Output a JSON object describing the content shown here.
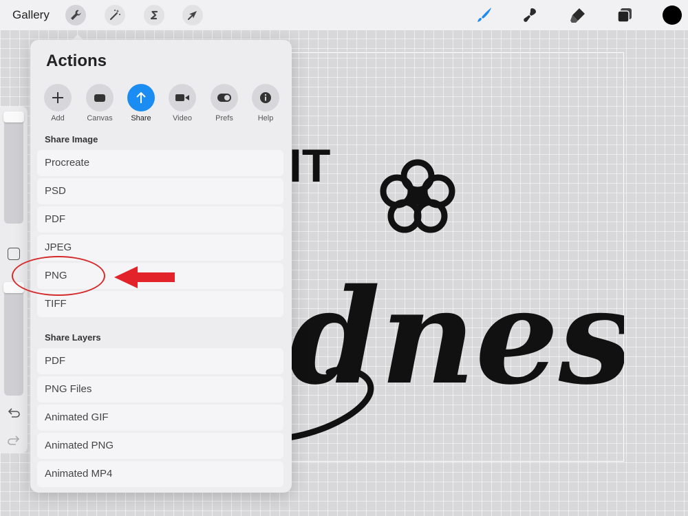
{
  "header": {
    "gallery_label": "Gallery",
    "left_tools": [
      "wrench-icon",
      "magic-wand-icon",
      "selection-s-icon",
      "transform-arrow-icon"
    ],
    "right_tools": [
      "brush-icon",
      "smudge-icon",
      "eraser-icon",
      "layers-icon"
    ],
    "current_color": "#000000",
    "accent": "#1b8cf2"
  },
  "actions": {
    "title": "Actions",
    "tabs": [
      {
        "label": "Add",
        "icon": "plus-icon"
      },
      {
        "label": "Canvas",
        "icon": "canvas-icon"
      },
      {
        "label": "Share",
        "icon": "upload-arrow-icon",
        "active": true
      },
      {
        "label": "Video",
        "icon": "video-camera-icon"
      },
      {
        "label": "Prefs",
        "icon": "toggle-icon"
      },
      {
        "label": "Help",
        "icon": "info-icon"
      }
    ],
    "share_image": {
      "heading": "Share Image",
      "items": [
        "Procreate",
        "PSD",
        "PDF",
        "JPEG",
        "PNG",
        "TIFF"
      ]
    },
    "share_layers": {
      "heading": "Share Layers",
      "items": [
        "PDF",
        "PNG Files",
        "Animated GIF",
        "Animated PNG",
        "Animated MP4"
      ]
    }
  },
  "artwork": {
    "text_fragments": [
      "IT",
      "dness"
    ]
  },
  "annotation": {
    "highlight_color": "#d42a2a",
    "highlighted_item": "PNG"
  }
}
